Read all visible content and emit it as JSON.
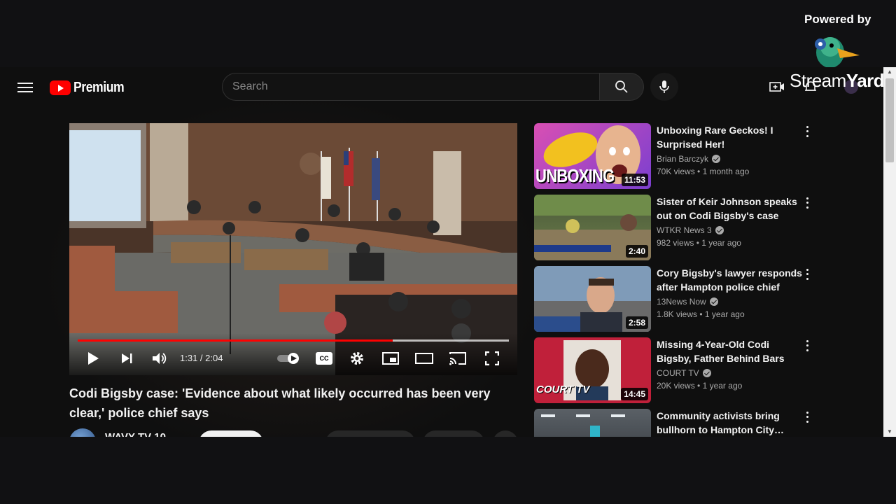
{
  "header": {
    "logo_text": "Premium",
    "search_placeholder": "Search"
  },
  "player": {
    "time": "1:31 / 2:04",
    "progress_fraction": 0.73,
    "cc_label": "CC"
  },
  "video": {
    "title": "Codi Bigsby case: 'Evidence about what likely occurred has been very clear,' police chief says",
    "channel": "WAVY TV 10"
  },
  "recommendations": [
    {
      "title": "Unboxing Rare Geckos! I Surprised Her!",
      "channel": "Brian Barczyk",
      "views": "70K views",
      "age": "1 month ago",
      "duration": "11:53",
      "overlay": "UNBOXING"
    },
    {
      "title": "Sister of Keir Johnson speaks out on Codi Bigsby's case",
      "channel": "WTKR News 3",
      "views": "982 views",
      "age": "1 year ago",
      "duration": "2:40"
    },
    {
      "title": "Cory Bigsby's lawyer responds after Hampton police chief say…",
      "channel": "13News Now",
      "views": "1.8K views",
      "age": "1 year ago",
      "duration": "2:58"
    },
    {
      "title": "Missing 4-Year-Old Codi Bigsby, Father Behind Bars",
      "channel": "COURT TV",
      "views": "20K views",
      "age": "1 year ago",
      "duration": "14:45",
      "overlay": "COURT TV"
    },
    {
      "title": "Community activists bring bullhorn to Hampton City…",
      "channel": "",
      "views": "",
      "age": "",
      "duration": ""
    }
  ],
  "streamyard": {
    "powered_by": "Powered by",
    "brand_a": "Stream",
    "brand_b": "Yard"
  },
  "colors": {
    "accent": "#ff0000",
    "bg": "#0f0f0f"
  }
}
